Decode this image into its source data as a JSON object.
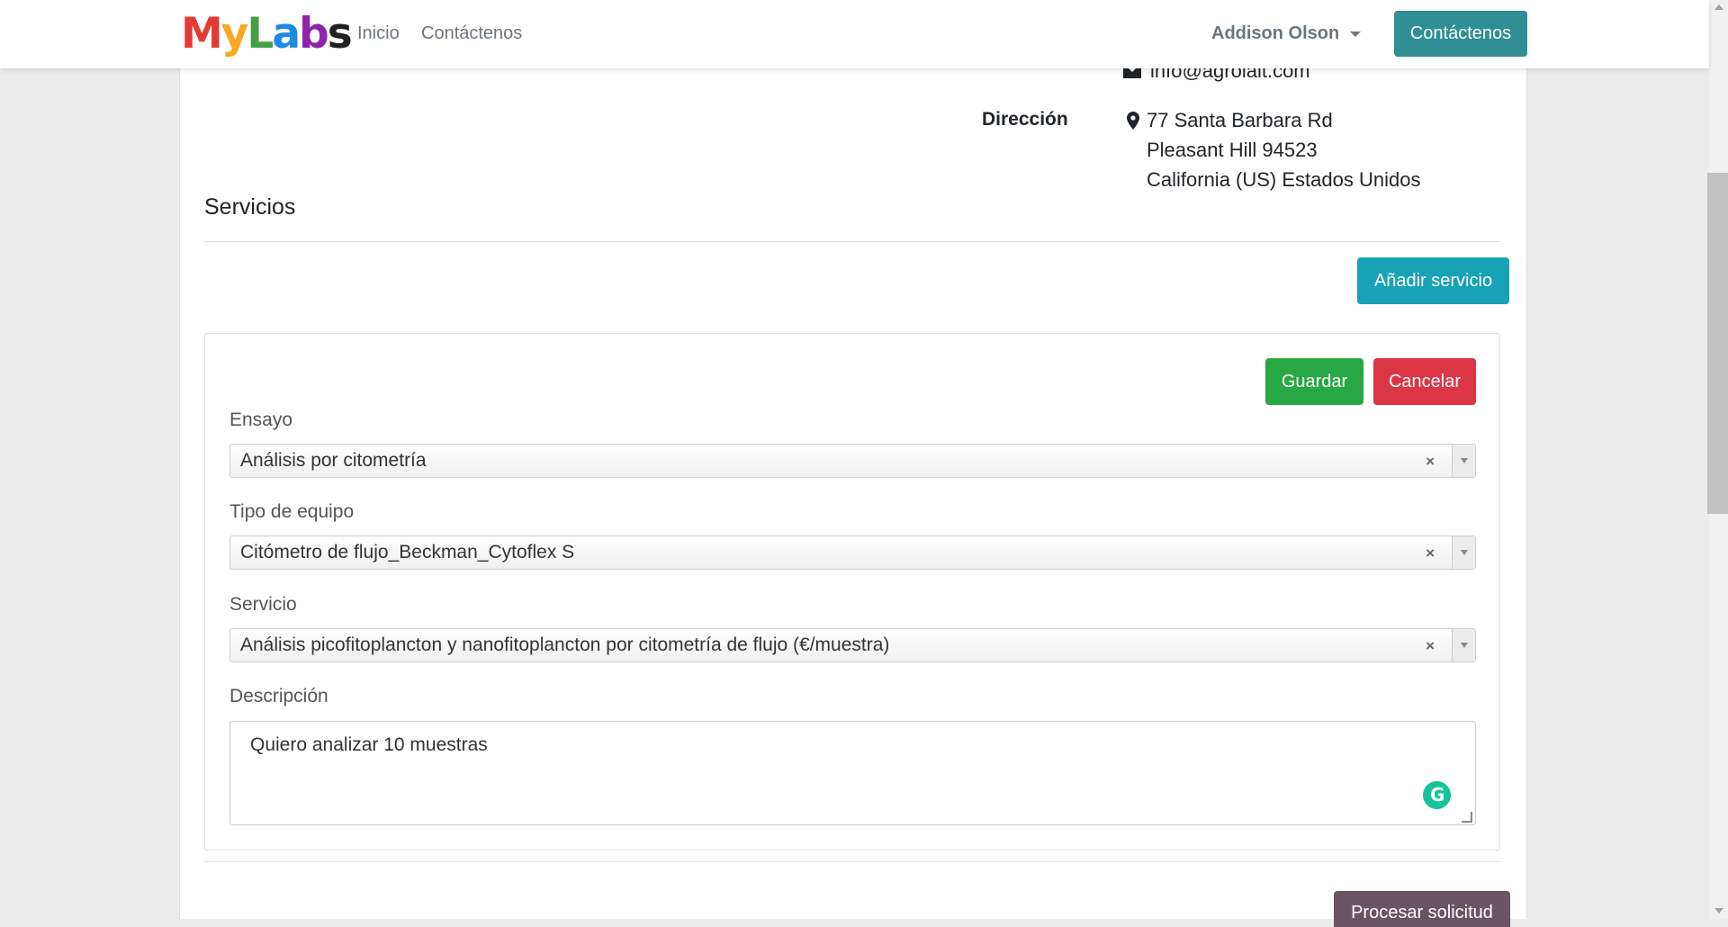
{
  "nav": {
    "logo": {
      "letters": [
        "M",
        "y",
        "L",
        "a",
        "b",
        "s"
      ],
      "colors": [
        "#e53935",
        "#f9a825",
        "#43a047",
        "#1e88e5",
        "#8e24aa",
        "#212121"
      ]
    },
    "links": [
      "Inicio",
      "Contáctenos"
    ],
    "user_name": "Addison Olson",
    "contact_button": "Contáctenos"
  },
  "company": {
    "email": "info@agrolait.com",
    "address_label": "Dirección",
    "address_lines": [
      "77 Santa Barbara Rd",
      "Pleasant Hill 94523",
      "California (US) Estados Unidos"
    ]
  },
  "services": {
    "title": "Servicios",
    "add_button": "Añadir servicio",
    "form": {
      "save_button": "Guardar",
      "cancel_button": "Cancelar",
      "ensayo": {
        "label": "Ensayo",
        "value": "Análisis por citometría"
      },
      "tipo_equipo": {
        "label": "Tipo de equipo",
        "value": "Citómetro de flujo_Beckman_Cytoflex S"
      },
      "servicio": {
        "label": "Servicio",
        "value": "Análisis picofitoplancton y nanofitoplancton por citometría de flujo (€/muestra)"
      },
      "descripcion": {
        "label": "Descripción",
        "value": "Quiero analizar 10 muestras"
      },
      "clear_symbol": "×"
    },
    "process_button": "Procesar solicitud"
  },
  "colors": {
    "contact_button": "#2f8f95",
    "add_button": "#17a2b8",
    "save_button": "#28a745",
    "cancel_button": "#dc3545",
    "process_button": "#6b5462"
  }
}
